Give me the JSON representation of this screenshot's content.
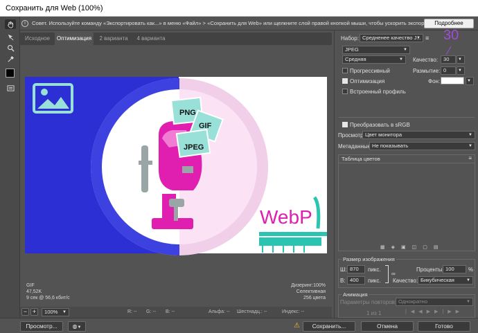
{
  "window": {
    "title": "Сохранить для Web (100%)"
  },
  "tip": {
    "text": "Совет. Используйте команду «Экспортировать как...» в меню «Файл» > «Сохранить для Web» или щелкните слой правой кнопкой мыши, чтобы ускорить экспорт ресурсов",
    "more_label": "Подробнее"
  },
  "tabs": [
    "Исходное",
    "Оптимизация",
    "2 варианта",
    "4 варианта"
  ],
  "artwork": {
    "labels": [
      "PNG",
      "GIF",
      "JPEG"
    ],
    "brand": "WebP"
  },
  "image_info": {
    "format": "GIF",
    "size": "47,52K",
    "time": "9 сек @ 56,6 кбит/с",
    "dither": "Дизеринг:100%",
    "palette": "Селективная",
    "colors": "256 цвета"
  },
  "status": {
    "zoom": "100%",
    "r": "R: --",
    "g": "G: --",
    "b": "B: --",
    "alpha": "Альфа: --",
    "hex": "Шестнадц.: --",
    "index": "Индекс: --"
  },
  "settings": {
    "preset_label": "Набор:",
    "preset_value": "Средненее качество J...",
    "format": "JPEG",
    "quality_preset": "Средняя",
    "quality_label": "Качество:",
    "quality_value": "30",
    "annotation": "30",
    "progressive": "Прогрессивный",
    "blur_label": "Размытие:",
    "blur_value": "0",
    "optimized": "Оптимизация",
    "matte_label": "Фон:",
    "embed_profile": "Встроенный профиль",
    "convert_srgb": "Преобразовать в sRGB",
    "preview_label": "Просмотр:",
    "preview_value": "Цвет монитора",
    "metadata_label": "Метаданные:",
    "metadata_value": "Не показывать",
    "color_table": "Таблица цветов"
  },
  "image_size": {
    "title": "Размер изображения",
    "w_label": "Ш:",
    "w_value": "870",
    "h_label": "В:",
    "h_value": "400",
    "unit": "пикс.",
    "percent_label": "Проценты:",
    "percent_value": "100",
    "percent_unit": "%",
    "quality_label": "Качество:",
    "quality_value": "Бикубическая"
  },
  "animation": {
    "title": "Анимация",
    "loop_label": "Параметры повторов:",
    "loop_value": "Однократно",
    "counter": "1 из 1"
  },
  "footer": {
    "preview": "Просмотр...",
    "save": "Сохранить...",
    "cancel": "Отмена",
    "done": "Готово"
  },
  "colors": {
    "accent_blue": "#2b2fd4",
    "magenta": "#e01eb0",
    "teal": "#2bc4b0",
    "bubble": "#98e0d8",
    "annotation": "#a04cd8"
  }
}
